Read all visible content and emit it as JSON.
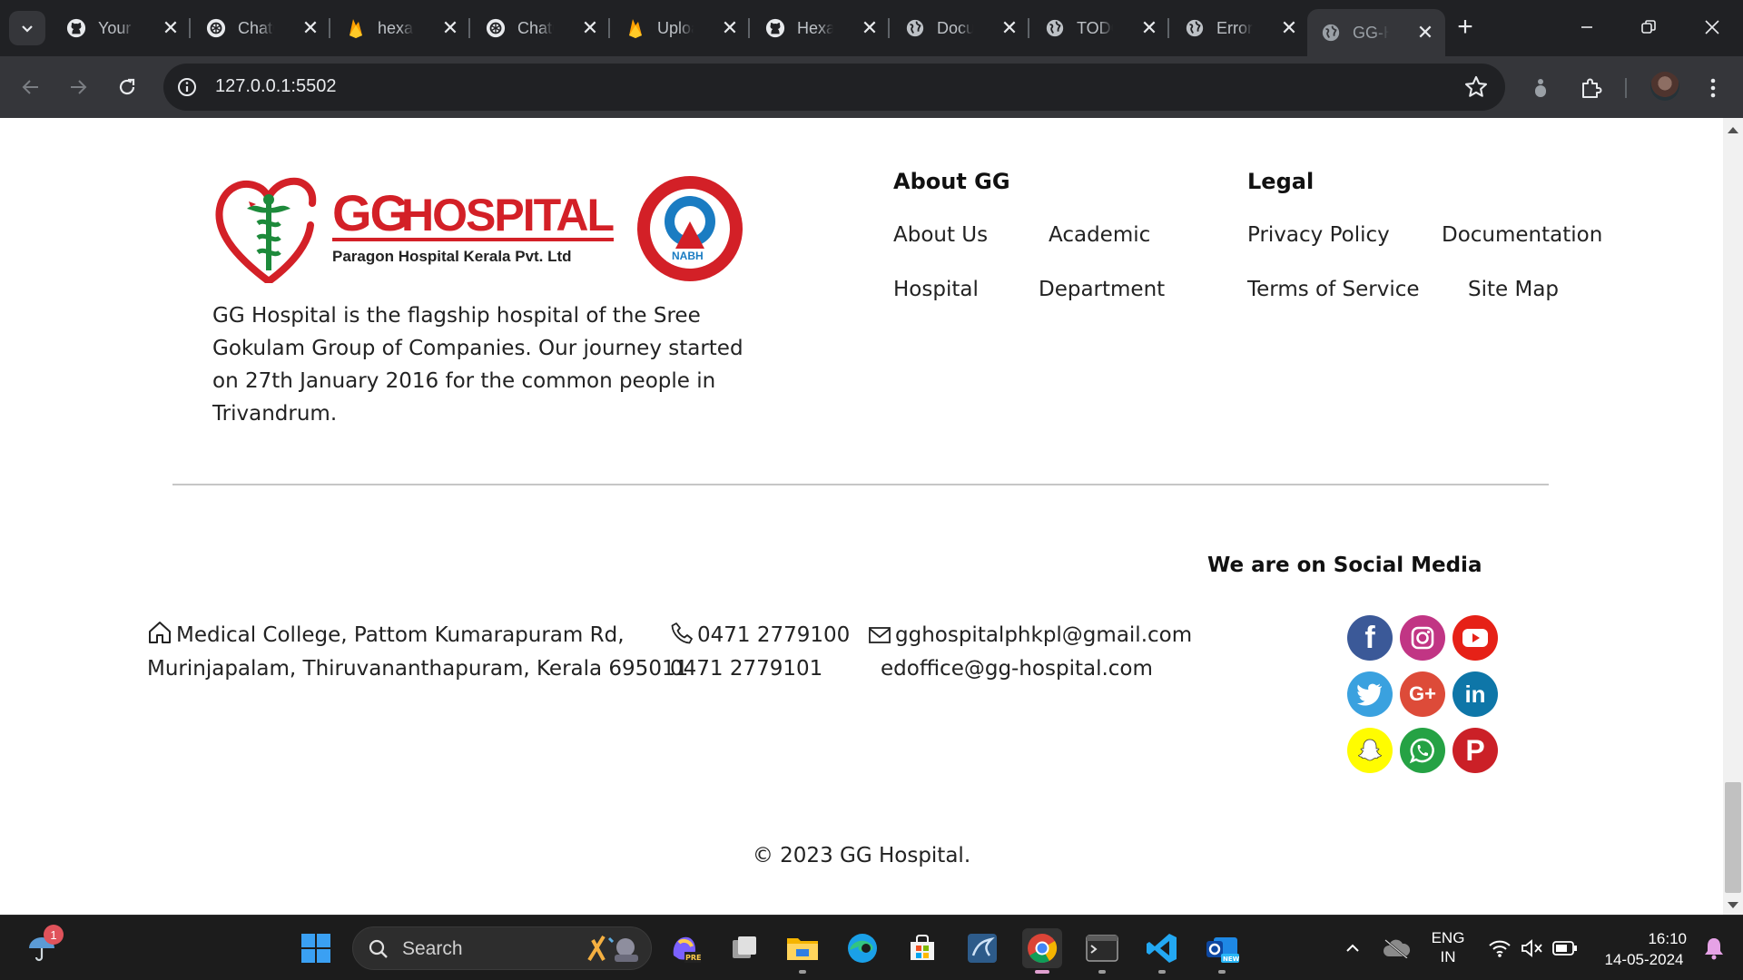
{
  "browser": {
    "tabs": [
      {
        "title": "Your R",
        "icon": "github-icon"
      },
      {
        "title": "ChatG",
        "icon": "chatgpt-icon"
      },
      {
        "title": "hexa-",
        "icon": "firebase-icon"
      },
      {
        "title": "ChatG",
        "icon": "chatgpt-icon"
      },
      {
        "title": "Uploa",
        "icon": "firebase-icon"
      },
      {
        "title": "Hexa-",
        "icon": "github-icon"
      },
      {
        "title": "Docur",
        "icon": "globe-icon"
      },
      {
        "title": "TODO",
        "icon": "globe-icon"
      },
      {
        "title": "Error",
        "icon": "globe-icon"
      },
      {
        "title": "GG-H",
        "icon": "globe-icon",
        "active": true
      }
    ],
    "url": "127.0.0.1:5502"
  },
  "footer": {
    "logo_lettering": "GGHOSPITAL Paragon Hospital Kerala Pvt. Ltd NABH",
    "about_text": "GG Hospital is the flagship hospital of the Sree Gokulam Group of Companies. Our journey started on 27th January 2016 for the common people in Trivandrum.",
    "about_heading": "About GG",
    "about_links": {
      "about_us": "About Us",
      "academic": "Academic",
      "hospital": "Hospital",
      "department": "Department"
    },
    "legal_heading": "Legal",
    "legal_links": {
      "privacy": "Privacy Policy",
      "documentation": "Documentation",
      "terms": "Terms of Service",
      "sitemap": "Site Map"
    },
    "social_heading": "We are on Social Media",
    "address_line1": "Medical College, Pattom Kumarapuram Rd,",
    "address_line2": "Murinjapalam, Thiruvananthapuram, Kerala 695011",
    "phone1": "0471 2779100",
    "phone2": "0471 2779101",
    "email1": "gghospitalphkpl@gmail.com",
    "email2": "edoffice@gg-hospital.com",
    "social_icons": [
      "facebook-icon",
      "instagram-icon",
      "youtube-icon",
      "twitter-icon",
      "google-plus-icon",
      "linkedin-icon",
      "snapchat-icon",
      "whatsapp-icon",
      "pinterest-icon"
    ],
    "copyright": "© 2023 GG Hospital."
  },
  "taskbar": {
    "search_label": "Search",
    "notification_count": "1",
    "lang_line1": "ENG",
    "lang_line2": "IN",
    "time": "16:10",
    "date": "14-05-2024"
  },
  "colors": {
    "facebook": "#3b5998",
    "instagram": "#c13584",
    "youtube": "#e62117",
    "twitter": "#3aa1df",
    "google_plus": "#dd4b39",
    "linkedin": "#0e76a8",
    "snapchat": "#fffc00",
    "whatsapp": "#25a244",
    "pinterest": "#cb2027"
  }
}
